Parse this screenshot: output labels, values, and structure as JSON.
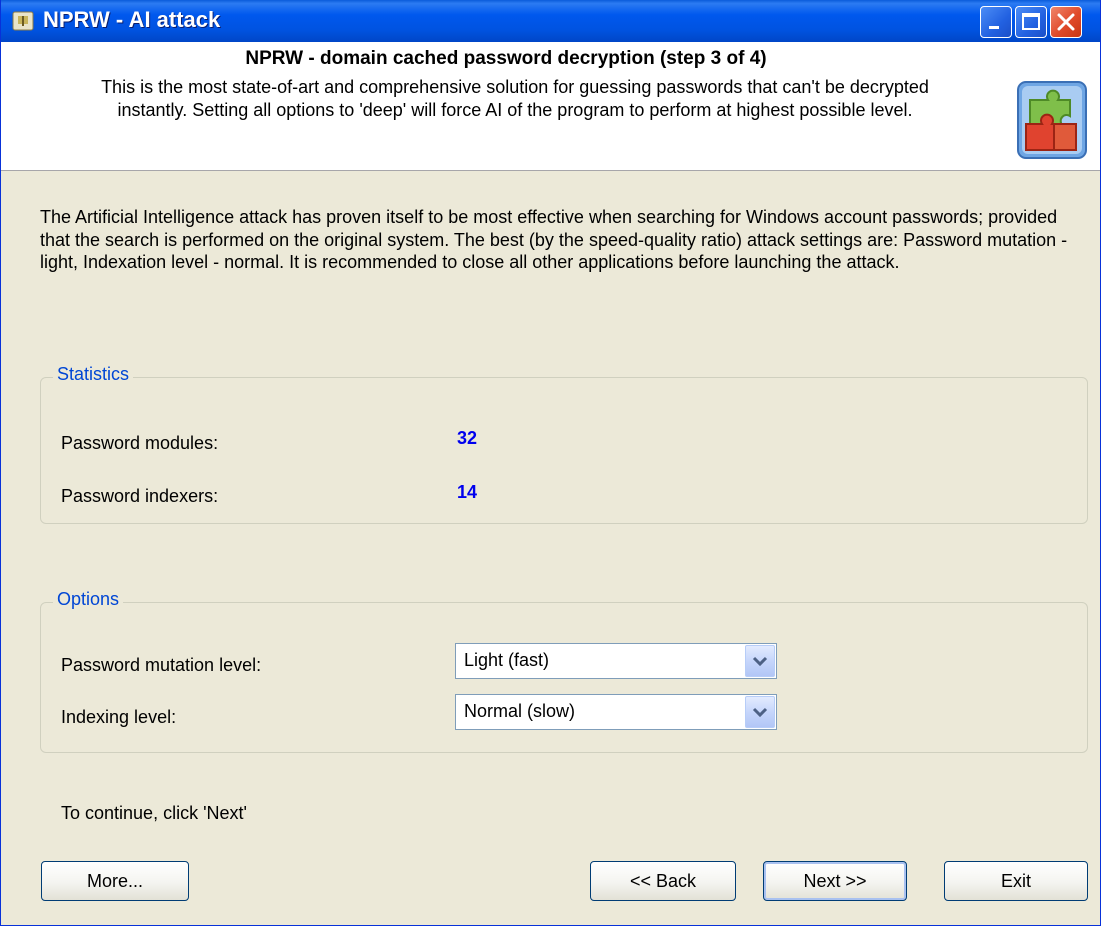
{
  "window": {
    "title": "NPRW - AI attack",
    "accent_color": "#0054E3",
    "caption_buttons": [
      {
        "name": "minimize-icon"
      },
      {
        "name": "maximize-icon"
      },
      {
        "name": "close-icon"
      }
    ]
  },
  "header": {
    "title": "NPRW - domain cached password decryption (step 3 of 4)",
    "description_line1": "This is the most state-of-art and comprehensive solution for guessing passwords that can't be decrypted",
    "description_line2": "instantly. Setting all options to 'deep' will force AI of the program to perform at highest possible level.",
    "logo_icon": "puzzle-icon"
  },
  "intro": {
    "text": "The Artificial Intelligence attack has proven itself to be most effective when searching for Windows account passwords; provided that the search is performed on the original system. The best (by the speed-quality ratio) attack settings are: Password mutation - light, Indexation level - normal. It is recommended to close all other applications before launching the attack."
  },
  "statistics": {
    "legend": "Statistics",
    "modules_label": "Password modules:",
    "modules_value": "32",
    "indexers_label": "Password indexers:",
    "indexers_value": "14",
    "value_color": "#0000EE"
  },
  "options": {
    "legend": "Options",
    "mutation_label": "Password mutation level:",
    "mutation_value": "Light (fast)",
    "indexing_label": "Indexing level:",
    "indexing_value": "Normal (slow)"
  },
  "footer": {
    "hint": "To continue, click 'Next'",
    "more_label": "More...",
    "back_label": "<< Back",
    "next_label": "Next >>",
    "exit_label": "Exit"
  }
}
